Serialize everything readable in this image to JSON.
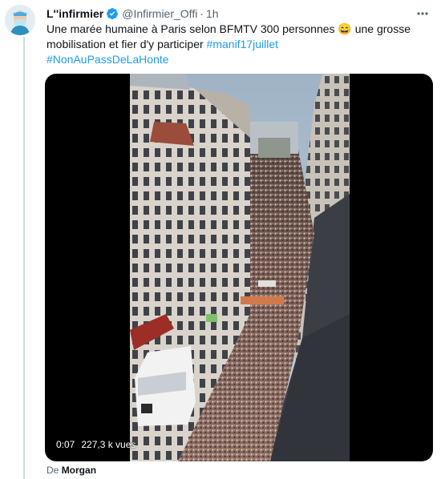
{
  "tweet": {
    "author_name": "L''infirmier",
    "author_handle": "@Infirmier_Offi",
    "separator": "·",
    "time": "1h",
    "text_prefix": "Une marée humaine à Paris selon BFMTV 300 personnes 😄 une grosse mobilisation et fier d'y participer ",
    "hashtags": [
      "#manif17juillet",
      "#NonAuPassDeLaHonte"
    ],
    "accent_color": "#1d9bf0",
    "verified_icon": "verified-badge"
  },
  "video": {
    "elapsed": "0:07",
    "views": "227,3 k vues"
  },
  "footer": {
    "from_label": "De",
    "from_name": "Morgan"
  }
}
